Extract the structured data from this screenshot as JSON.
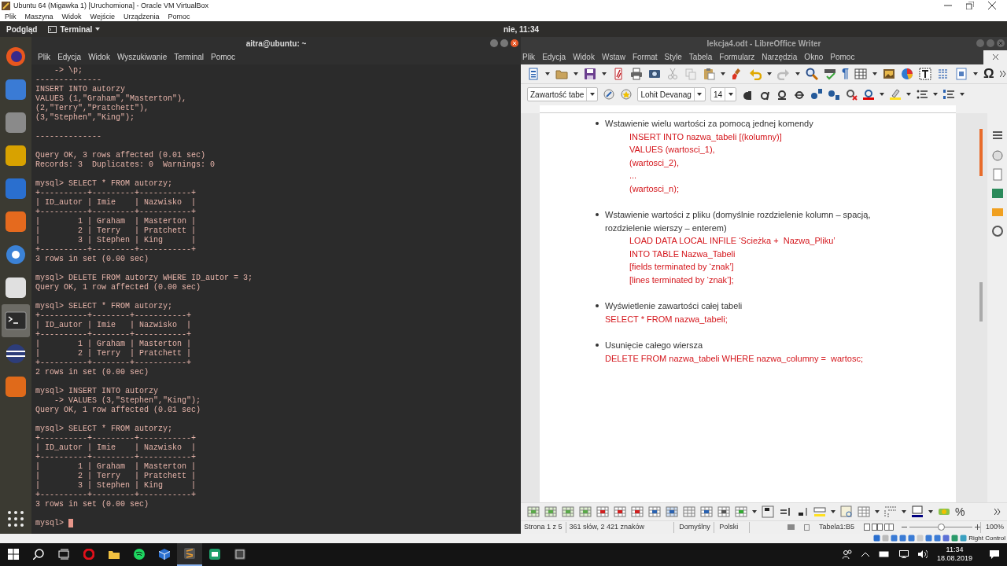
{
  "vbox": {
    "title": "Ubuntu 64 (Migawka 1) [Uruchomiona] - Oracle VM VirtualBox",
    "menu": [
      "Plik",
      "Maszyna",
      "Widok",
      "Wejście",
      "Urządzenia",
      "Pomoc"
    ],
    "status_text": "Right Control"
  },
  "ubuntu_panel": {
    "activities": "Podgląd",
    "app": "Terminal",
    "clock": "nie, 11:34"
  },
  "launcher": {
    "items": [
      {
        "selected": false
      },
      {
        "selected": false
      },
      {
        "selected": false
      },
      {
        "selected": false
      },
      {
        "selected": false
      },
      {
        "selected": false
      },
      {
        "selected": false
      },
      {
        "selected": false
      },
      {
        "selected": true
      },
      {
        "selected": false
      },
      {
        "selected": false
      }
    ]
  },
  "terminal": {
    "title": "aitra@ubuntu: ~",
    "menu": [
      "Plik",
      "Edycja",
      "Widok",
      "Wyszukiwanie",
      "Terminal",
      "Pomoc"
    ],
    "blocks": [
      [
        "    -> \\p;",
        "--------------",
        "INSERT INTO autorzy",
        "VALUES (1,\"Graham\",\"Masterton\"),",
        "(2,\"Terry\",\"Pratchett\"),",
        "(3,\"Stephen\",\"King\");"
      ],
      [
        "--------------"
      ],
      [
        "Query OK, 3 rows affected (0.01 sec)",
        "Records: 3  Duplicates: 0  Warnings: 0"
      ],
      [
        "mysql> SELECT * FROM autorzy;",
        "+----------+---------+-----------+",
        "| ID_autor | Imie    | Nazwisko  |",
        "+----------+---------+-----------+",
        "|        1 | Graham  | Masterton |",
        "|        2 | Terry   | Pratchett |",
        "|        3 | Stephen | King      |",
        "+----------+---------+-----------+",
        "3 rows in set (0.00 sec)"
      ],
      [
        "mysql> DELETE FROM autorzy WHERE ID_autor = 3;",
        "Query OK, 1 row affected (0.00 sec)"
      ],
      [
        "mysql> SELECT * FROM autorzy;",
        "+----------+--------+-----------+",
        "| ID_autor | Imie   | Nazwisko  |",
        "+----------+--------+-----------+",
        "|        1 | Graham | Masterton |",
        "|        2 | Terry  | Pratchett |",
        "+----------+--------+-----------+",
        "2 rows in set (0.00 sec)"
      ],
      [
        "mysql> INSERT INTO autorzy",
        "    -> VALUES (3,\"Stephen\",\"King\");",
        "Query OK, 1 row affected (0.01 sec)"
      ],
      [
        "mysql> SELECT * FROM autorzy;",
        "+----------+---------+-----------+",
        "| ID_autor | Imie    | Nazwisko  |",
        "+----------+---------+-----------+",
        "|        1 | Graham  | Masterton |",
        "|        2 | Terry   | Pratchett |",
        "|        3 | Stephen | King      |",
        "+----------+---------+-----------+",
        "3 rows in set (0.00 sec)"
      ],
      [
        "mysql> "
      ]
    ]
  },
  "writer": {
    "title": "lekcja4.odt - LibreOffice Writer",
    "menu": [
      "Plik",
      "Edycja",
      "Widok",
      "Wstaw",
      "Format",
      "Style",
      "Tabela",
      "Formularz",
      "Narzędzia",
      "Okno",
      "Pomoc"
    ],
    "toolbar_glyphs": {
      "formatting_marks": "¶",
      "special_character": "Ω",
      "percent": "%"
    },
    "paragraph_style": "Zawartość tabe",
    "font_name": "Lohit Devanag",
    "font_size": "14",
    "document": [
      {
        "text": "Wstawienie wielu wartości za pomocą jednej komendy",
        "code_indented": true,
        "code": [
          "INSERT INTO nazwa_tabeli [(kolumny)]",
          "VALUES (wartosci_1),",
          "(wartosci_2),",
          "...",
          "(wartosci_n);"
        ]
      },
      {
        "text": "Wstawienie wartości z pliku (domyślnie rozdzielenie kolumn – spacją, rozdzielenie wierszy – enterem)",
        "code_indented": true,
        "code": [
          "LOAD DATA LOCAL INFILE ‘Scieżka +  Nazwa_Pliku’",
          "INTO TABLE Nazwa_Tabeli",
          "[fields terminated by ‘znak’]",
          "[lines terminated by ‘znak’];"
        ]
      },
      {
        "text": "Wyświetlenie zawartości całej tabeli",
        "code_indented": false,
        "code": [
          "SELECT * FROM nazwa_tabeli;"
        ]
      },
      {
        "text": "Usunięcie całego wiersza",
        "code_indented": false,
        "code": [
          "DELETE FROM nazwa_tabeli WHERE nazwa_columny =  wartosc;"
        ]
      }
    ],
    "status": [
      "Strona 1 z 5",
      "361 słów, 2 421 znaków",
      "Domyślny",
      "Polski",
      "Tabela1:B5"
    ],
    "zoom": {
      "label": "100%",
      "level": 0.5
    }
  },
  "taskbar": {
    "time": "11:34",
    "date": "18.08.2019"
  }
}
